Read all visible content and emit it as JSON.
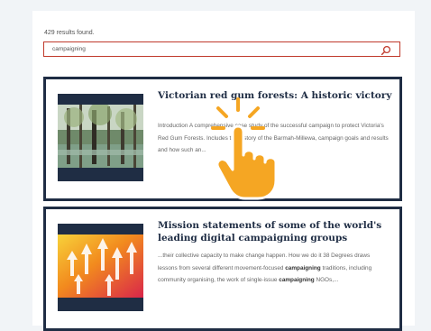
{
  "results": {
    "count_text": "429 results found."
  },
  "search": {
    "value": "campaigning",
    "icon": "search-icon",
    "accent_color": "#c0392b"
  },
  "cards": [
    {
      "title": "Victorian red gum forests: A historic victory",
      "excerpt": "Introduction A comprehensive case study of the successful campaign to protect Victoria's Red Gum Forests. Includes the history of the Barmah-Millewa, campaign goals and results and how such an..."
    },
    {
      "title": "Mission statements of some of the world's leading digital campaigning groups",
      "excerpt_parts": [
        "...their collective capacity to make change happen. How we do it 38 Degrees draws lessons from several different movement-focused ",
        "campaigning",
        " traditions, including community organising, the work of single-issue ",
        "campaigning",
        " NGOs,..."
      ]
    }
  ],
  "overlay": {
    "icon": "pointing-hand-cursor-icon"
  },
  "colors": {
    "card_border": "#1f2d44",
    "title": "#1f2d44",
    "page_bg": "#f1f4f7"
  }
}
